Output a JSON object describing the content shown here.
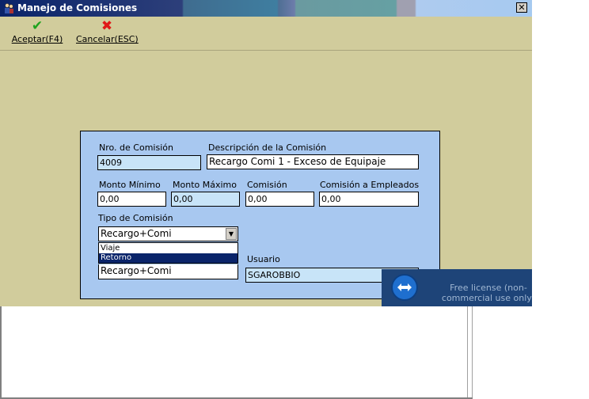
{
  "window": {
    "title": "Manejo de Comisiones",
    "close_glyph": "✕",
    "app_icon": "people-icon"
  },
  "toolbar": {
    "accept": {
      "icon": "✔",
      "label": "Aceptar(F4)"
    },
    "cancel": {
      "icon": "✖",
      "label": "Cancelar(ESC)"
    }
  },
  "form": {
    "nro_label": "Nro. de Comisión",
    "nro_value": "4009",
    "desc_label": "Descripción de la Comisión",
    "desc_value": "Recargo Comi 1 - Exceso de Equipaje",
    "min_label": "Monto Mínimo",
    "min_value": "0,00",
    "max_label": "Monto Máximo",
    "max_value": "0,00",
    "comision_label": "Comisión",
    "comision_value": "0,00",
    "empleados_label": "Comisión a Empleados",
    "empleados_value": "0,00",
    "tipo_label": "Tipo de Comisión",
    "tipo_value": "Recargo+Comi",
    "tipo_options": [
      "Viaje",
      "Retorno",
      "Recargo+Comi"
    ],
    "tipo_highlighted": "Retorno",
    "usuario_label": "Usuario",
    "usuario_value": "SGAROBBIO"
  },
  "overlay": {
    "text": "Free license (non-commercial use only)"
  },
  "colors": {
    "window_bg": "#d1cc9c",
    "panel_bg": "#a8c8f0",
    "title_start": "#0a246a"
  }
}
